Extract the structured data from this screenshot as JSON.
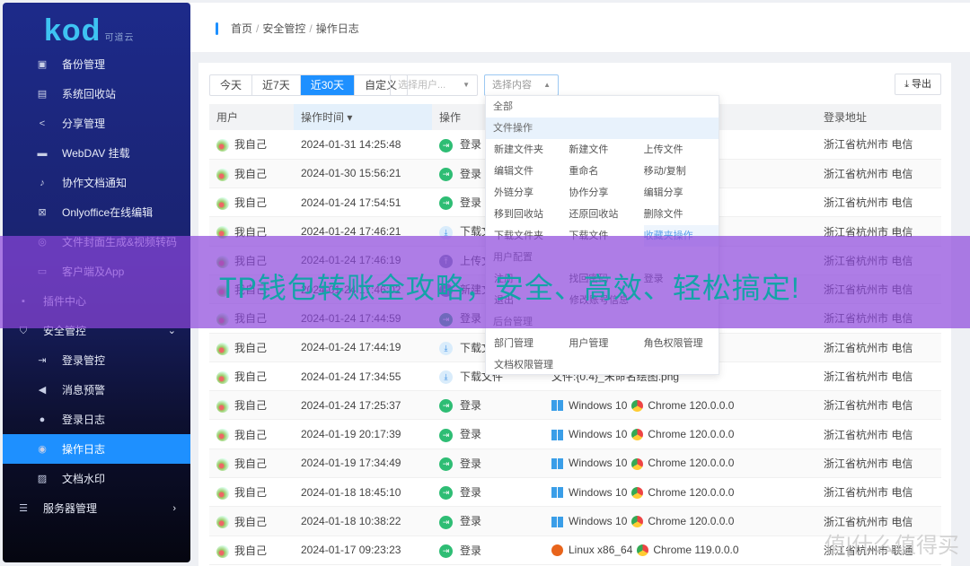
{
  "logo": {
    "text": "kod",
    "sub": "可道云"
  },
  "sidebar": {
    "items": [
      {
        "label": "备份管理",
        "icon": "backup-icon",
        "level": 2
      },
      {
        "label": "系统回收站",
        "icon": "recycle-icon",
        "level": 2
      },
      {
        "label": "分享管理",
        "icon": "share-icon",
        "level": 2
      },
      {
        "label": "WebDAV 挂载",
        "icon": "drive-icon",
        "level": 2
      },
      {
        "label": "协作文档通知",
        "icon": "bell-icon",
        "level": 2
      },
      {
        "label": "Onlyoffice在线编辑",
        "icon": "office-icon",
        "level": 2
      },
      {
        "label": "文件封面生成&视频转码",
        "icon": "video-icon",
        "level": 2
      },
      {
        "label": "客户端及App",
        "icon": "monitor-icon",
        "level": 2
      },
      {
        "label": "插件中心",
        "icon": "plugin-icon",
        "level": 1
      },
      {
        "label": "安全管控",
        "icon": "shield-icon",
        "level": 1,
        "arrow": "⌄"
      },
      {
        "label": "登录管控",
        "icon": "login-icon",
        "level": 2
      },
      {
        "label": "消息预警",
        "icon": "speaker-icon",
        "level": 2
      },
      {
        "label": "登录日志",
        "icon": "user-pin-icon",
        "level": 2
      },
      {
        "label": "操作日志",
        "icon": "location-icon",
        "level": 2,
        "active": true
      },
      {
        "label": "文档水印",
        "icon": "image-icon",
        "level": 2
      },
      {
        "label": "服务器管理",
        "icon": "server-icon",
        "level": 1,
        "arrow": "›"
      }
    ]
  },
  "breadcrumb": [
    "首页",
    "安全管控",
    "操作日志"
  ],
  "filters": {
    "ranges": [
      "今天",
      "近7天",
      "近30天",
      "自定义"
    ],
    "active_range": "近30天",
    "user_placeholder": "选择用户...",
    "content_placeholder": "选择内容",
    "export": "导出"
  },
  "table": {
    "headers": [
      "用户",
      "操作时间 ▾",
      "操作",
      "",
      "登录地址"
    ],
    "rows": [
      {
        "user": "我自己",
        "time": "2024-01-31 14:25:48",
        "op": "登录",
        "type": "login",
        "os": "",
        "browser": "",
        "addr": "浙江省杭州市 电信"
      },
      {
        "user": "我自己",
        "time": "2024-01-30 15:56:21",
        "op": "登录",
        "type": "login",
        "os": "",
        "browser": "",
        "addr": "浙江省杭州市 电信"
      },
      {
        "user": "我自己",
        "time": "2024-01-24 17:54:51",
        "op": "登录",
        "type": "login",
        "os": "",
        "browser": "",
        "addr": "浙江省杭州市 电信"
      },
      {
        "user": "我自己",
        "time": "2024-01-24 17:46:21",
        "op": "下载文件",
        "type": "down",
        "os": "",
        "browser": "",
        "addr": "浙江省杭州市 电信"
      },
      {
        "user": "我自己",
        "time": "2024-01-24 17:46:19",
        "op": "上传文件",
        "type": "up",
        "os": "",
        "browser": "",
        "addr": "浙江省杭州市 电信"
      },
      {
        "user": "我自己",
        "time": "2024-01-24 17:46:02",
        "op": "新建文件",
        "type": "new",
        "os": "",
        "browser": "",
        "addr": "浙江省杭州市 电信"
      },
      {
        "user": "我自己",
        "time": "2024-01-24 17:44:59",
        "op": "登录",
        "type": "login",
        "os": "",
        "browser": "",
        "addr": "浙江省杭州市 电信"
      },
      {
        "user": "我自己",
        "time": "2024-01-24 17:44:19",
        "op": "下载文件",
        "type": "down",
        "os": "",
        "browser": "",
        "addr": "浙江省杭州市 电信"
      },
      {
        "user": "我自己",
        "time": "2024-01-24 17:34:55",
        "op": "下载文件",
        "type": "down",
        "os": "文件:{0.4}_未命名绘图.png",
        "browser": "",
        "addr": "浙江省杭州市 电信"
      },
      {
        "user": "我自己",
        "time": "2024-01-24 17:25:37",
        "op": "登录",
        "type": "login",
        "os": "Windows 10",
        "browser": "Chrome 120.0.0.0",
        "addr": "浙江省杭州市 电信"
      },
      {
        "user": "我自己",
        "time": "2024-01-19 20:17:39",
        "op": "登录",
        "type": "login",
        "os": "Windows 10",
        "browser": "Chrome 120.0.0.0",
        "addr": "浙江省杭州市 电信"
      },
      {
        "user": "我自己",
        "time": "2024-01-19 17:34:49",
        "op": "登录",
        "type": "login",
        "os": "Windows 10",
        "browser": "Chrome 120.0.0.0",
        "addr": "浙江省杭州市 电信"
      },
      {
        "user": "我自己",
        "time": "2024-01-18 18:45:10",
        "op": "登录",
        "type": "login",
        "os": "Windows 10",
        "browser": "Chrome 120.0.0.0",
        "addr": "浙江省杭州市 电信"
      },
      {
        "user": "我自己",
        "time": "2024-01-18 10:38:22",
        "op": "登录",
        "type": "login",
        "os": "Windows 10",
        "browser": "Chrome 120.0.0.0",
        "addr": "浙江省杭州市 电信"
      },
      {
        "user": "我自己",
        "time": "2024-01-17 09:23:23",
        "op": "登录",
        "type": "login",
        "os": "Linux x86_64",
        "browser": "Chrome 119.0.0.0",
        "addr": "浙江省杭州市 联通"
      }
    ]
  },
  "dropdown": {
    "groups": [
      {
        "title": "全部",
        "rows": []
      },
      {
        "title": "文件操作",
        "highlight": true,
        "rows": [
          [
            "新建文件夹",
            "新建文件",
            "上传文件"
          ],
          [
            "编辑文件",
            "重命名",
            "移动/复制"
          ],
          [
            "外链分享",
            "协作分享",
            "编辑分享"
          ],
          [
            "移到回收站",
            "还原回收站",
            "删除文件"
          ],
          [
            "下载文件夹",
            "下载文件",
            "收藏夹操作"
          ]
        ]
      },
      {
        "title": "用户配置",
        "rows": [
          [
            "注册",
            "找回密码",
            "登录"
          ],
          [
            "退出",
            "修改账号信息"
          ]
        ]
      },
      {
        "title": "后台管理",
        "rows": [
          [
            "部门管理",
            "用户管理",
            "角色权限管理"
          ],
          [
            "文档权限管理"
          ]
        ]
      }
    ],
    "active": "收藏夹操作"
  },
  "banner": "TP钱包转账全攻略，安全、高效、轻松搞定!",
  "watermark": "值 什么值得买",
  "colors": {
    "accent": "#1e90ff",
    "login": "#2ebd74",
    "banner": "#8c46dc",
    "banner_text": "#14a3a8"
  }
}
